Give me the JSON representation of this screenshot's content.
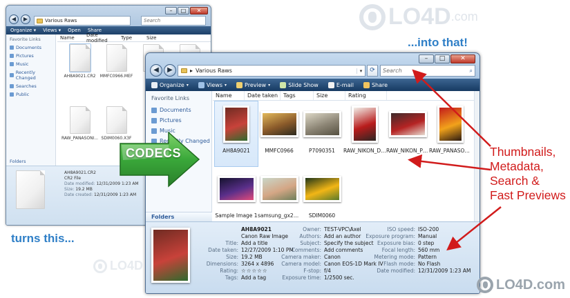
{
  "watermark": {
    "brand": "LO4D",
    "suffix": ".com"
  },
  "captions": {
    "into": "...into that!",
    "turns": "turns this...",
    "codecs": "CODECS"
  },
  "callout": [
    "Thumbnails,",
    "Metadata,",
    "Search &",
    "Fast Previews"
  ],
  "back_window": {
    "address": "Various Raws",
    "search_placeholder": "Search",
    "toolbar": [
      "Organize ▾",
      "Views ▾",
      "Open",
      "Share"
    ],
    "columns": [
      "Name",
      "Date modified",
      "Type",
      "Size"
    ],
    "sidebar_header": "Favorite Links",
    "sidebar_items": [
      "Documents",
      "Pictures",
      "Music",
      "Recently Changed",
      "Searches",
      "Public"
    ],
    "folders_label": "Folders",
    "files": [
      "AH8A9021.CR2",
      "MMFC0966.MEF",
      "P709",
      "RAW_NIKON_P6...",
      "RAW_PANASONI...",
      "SDIM0060.X3F"
    ],
    "details": {
      "name": "AH8A9021.CR2",
      "type": "CR2 File",
      "rows": [
        {
          "k": "Date modified:",
          "v": "12/31/2009 1:23 AM"
        },
        {
          "k": "Size:",
          "v": "19.2 MB"
        },
        {
          "k": "Date created:",
          "v": "12/31/2009 1:23 AM"
        }
      ]
    }
  },
  "front_window": {
    "address": "Various Raws",
    "search_placeholder": "Search",
    "toolbar": [
      {
        "label": "Organize",
        "caret": "▾",
        "icon": "#e9eef4"
      },
      {
        "label": "Views",
        "caret": "▾",
        "icon": "#9fc1e6"
      },
      {
        "label": "Preview",
        "caret": "▾",
        "icon": "#f0d070"
      },
      {
        "label": "Slide Show",
        "caret": "",
        "icon": "#cfe6a8"
      },
      {
        "label": "E-mail",
        "caret": "",
        "icon": "#f2f2f2"
      },
      {
        "label": "Share",
        "caret": "",
        "icon": "#f2c45e"
      }
    ],
    "columns": [
      "Name",
      "Date taken",
      "Tags",
      "Size",
      "Rating"
    ],
    "sidebar_header": "Favorite Links",
    "sidebar_items": [
      "Documents",
      "Pictures",
      "Music",
      "Recently Changed",
      "Searches",
      "Public"
    ],
    "folders_label": "Folders",
    "files": [
      {
        "name": "AH8A9021",
        "orient": "p",
        "selected": true,
        "colors": [
          "#6f2b22",
          "#c8423a",
          "#2f6a2d"
        ]
      },
      {
        "name": "MMFC0966",
        "orient": "l",
        "selected": false,
        "colors": [
          "#e3b95a",
          "#8a5a2a",
          "#2c2a1e"
        ]
      },
      {
        "name": "P7090351",
        "orient": "l",
        "selected": false,
        "colors": [
          "#dcd7c6",
          "#8c8575",
          "#565141"
        ]
      },
      {
        "name": "RAW_NIKON_D3X",
        "orient": "p",
        "selected": false,
        "colors": [
          "#f1efe9",
          "#b81c1c",
          "#2b2623"
        ]
      },
      {
        "name": "RAW_NIKON_P6...",
        "orient": "l",
        "selected": false,
        "colors": [
          "#3d2a2a",
          "#b52323",
          "#e6dbd0"
        ]
      },
      {
        "name": "RAW_PANASON...",
        "orient": "p",
        "selected": false,
        "colors": [
          "#c31b1b",
          "#f2a21b",
          "#2b1a12"
        ]
      },
      {
        "name": "Sample Image 1",
        "orient": "l",
        "selected": false,
        "colors": [
          "#15122e",
          "#5a2f8a",
          "#e24a7a"
        ]
      },
      {
        "name": "samsung_gx20_03",
        "orient": "l",
        "selected": false,
        "colors": [
          "#c9d6c8",
          "#d4a685",
          "#6d7f5a"
        ]
      },
      {
        "name": "SDIM0060",
        "orient": "l",
        "selected": false,
        "colors": [
          "#1f3518",
          "#f2b616",
          "#5a7a2a"
        ]
      }
    ],
    "details": {
      "col1": [
        {
          "k": "",
          "v": "AH8A9021"
        },
        {
          "k": "",
          "v": "Canon Raw Image"
        },
        {
          "k": "Title:",
          "v": "Add a title"
        },
        {
          "k": "Date taken:",
          "v": "12/27/2009 1:10 PM"
        },
        {
          "k": "Size:",
          "v": "19.2 MB"
        },
        {
          "k": "Dimensions:",
          "v": "3264 x 4896"
        },
        {
          "k": "Rating:",
          "v": "☆☆☆☆☆"
        },
        {
          "k": "Tags:",
          "v": "Add a tag"
        }
      ],
      "col2": [
        {
          "k": "Owner:",
          "v": "TEST-VPC\\Axel"
        },
        {
          "k": "Authors:",
          "v": "Add an author"
        },
        {
          "k": "Subject:",
          "v": "Specify the subject"
        },
        {
          "k": "Comments:",
          "v": "Add comments"
        },
        {
          "k": "Camera maker:",
          "v": "Canon"
        },
        {
          "k": "Camera model:",
          "v": "Canon EOS-1D Mark IV"
        },
        {
          "k": "F-stop:",
          "v": "f/4"
        },
        {
          "k": "Exposure time:",
          "v": "1/2500 sec."
        }
      ],
      "col3": [
        {
          "k": "ISO speed:",
          "v": "ISO-200"
        },
        {
          "k": "Exposure program:",
          "v": "Manual"
        },
        {
          "k": "Exposure bias:",
          "v": "0 step"
        },
        {
          "k": "Focal length:",
          "v": "560 mm"
        },
        {
          "k": "Metering mode:",
          "v": "Pattern"
        },
        {
          "k": "Flash mode:",
          "v": "No Flash"
        },
        {
          "k": "Date modified:",
          "v": "12/31/2009 1:23 AM"
        }
      ]
    }
  },
  "colors": {
    "accent_blue": "#2f7fc7",
    "callout_red": "#d11b1b",
    "codecs_green": "#3aa83a"
  }
}
